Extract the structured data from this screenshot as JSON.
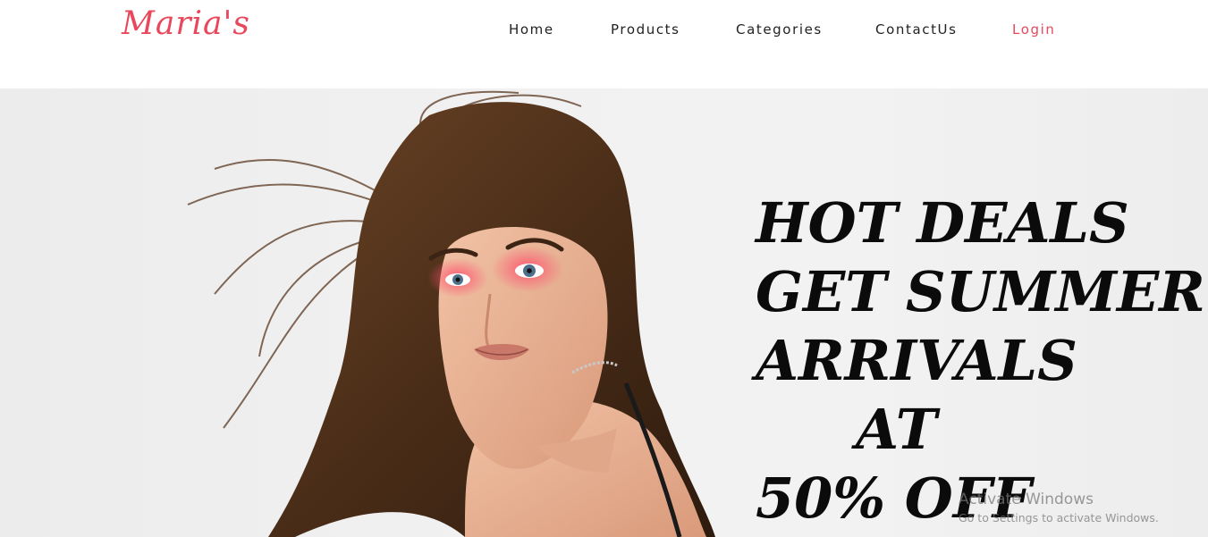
{
  "brand": {
    "logo_text": "Maria's",
    "accent_color": "#e8475c"
  },
  "nav": {
    "home": "Home",
    "products": "Products",
    "categories": "Categories",
    "contact": "ContactUs",
    "login": "Login"
  },
  "hero": {
    "headline_lines": [
      "HOT DEALS",
      "GET SUMMER",
      "ARRIVALS",
      "AT",
      "50% OFF"
    ]
  },
  "watermark": {
    "title": "Activate Windows",
    "subtitle": "Go to Settings to activate Windows."
  }
}
